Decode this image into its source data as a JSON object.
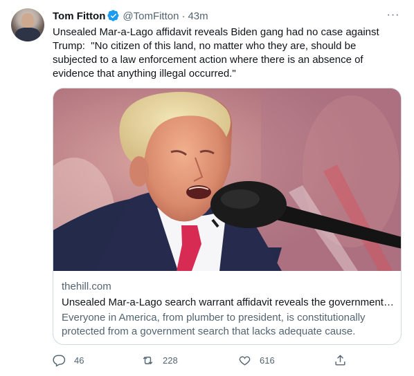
{
  "tweet": {
    "author_name": "Tom Fitton",
    "handle": "@TomFitton",
    "separator": "·",
    "time": "43m",
    "more": "···",
    "text": "Unsealed Mar-a-Lago affidavit reveals Biden gang had no case against Trump:  \"No citizen of this land, no matter who they are, should be subjected to a law enforcement action where there is an absence of evidence that anything illegal occurred.\""
  },
  "card": {
    "domain": "thehill.com",
    "title": "Unsealed Mar-a-Lago search warrant affidavit reveals the government…",
    "description": "Everyone in America, from plumber to president, is constitutionally protected from a government search that lacks adequate cause."
  },
  "actions": {
    "replies": "46",
    "retweets": "228",
    "likes": "616"
  },
  "colors": {
    "text": "#0f1419",
    "secondary": "#536471",
    "verified": "#1d9bf0",
    "border": "#cfd9de"
  },
  "icons": {
    "verified": "verified-badge-icon",
    "more": "more-icon",
    "reply": "reply-icon",
    "retweet": "retweet-icon",
    "like": "like-icon",
    "share": "share-icon"
  }
}
